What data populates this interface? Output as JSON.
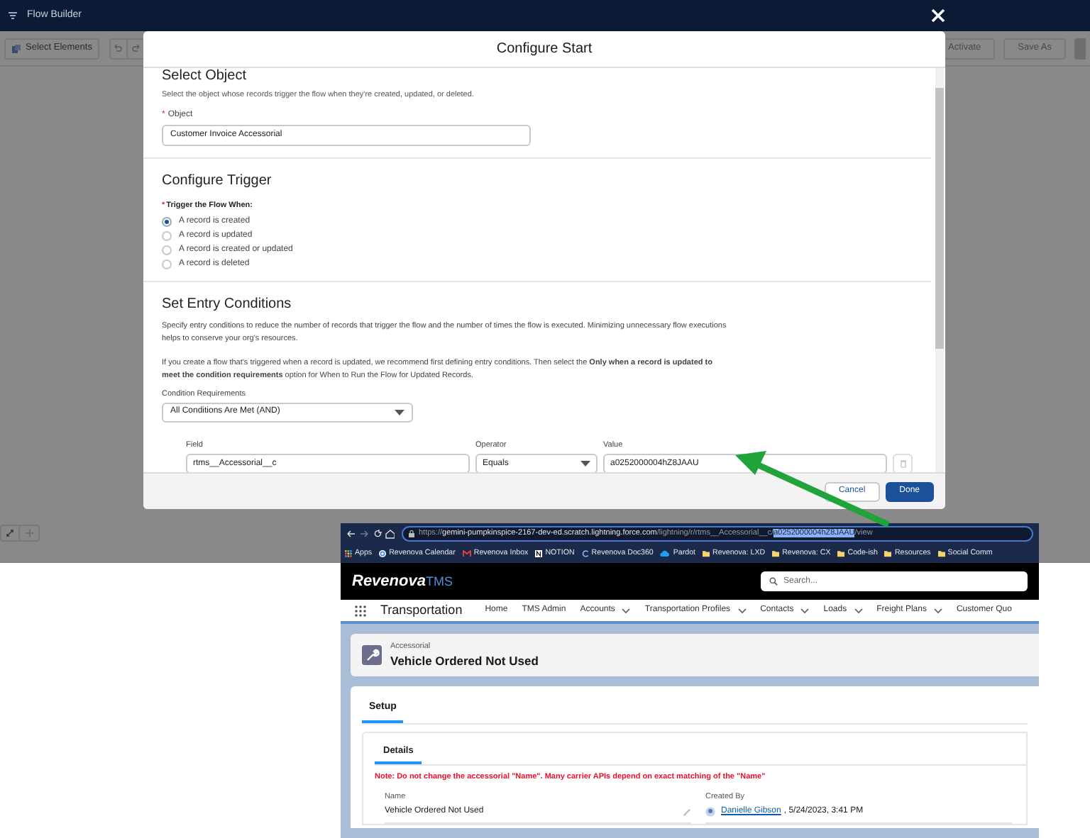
{
  "app_bar": {
    "title": "Flow Builder"
  },
  "toolbar": {
    "left_buttons": [
      {
        "label": "Select Elements"
      }
    ],
    "right_buttons": [
      {
        "label": "Activate"
      },
      {
        "label": "Save As"
      }
    ]
  },
  "modal": {
    "title": "Configure Start",
    "select_object": {
      "heading": "Select Object",
      "description": "Select the object whose records trigger the flow when they're created, updated, or deleted.",
      "required_mark": "*",
      "field_label": "Object",
      "value": "Customer Invoice Accessorial"
    },
    "trigger": {
      "heading": "Configure Trigger",
      "required_mark": "*",
      "label": "Trigger the Flow When:",
      "options": [
        {
          "label": "A record is created",
          "selected": true
        },
        {
          "label": "A record is updated",
          "selected": false
        },
        {
          "label": "A record is created or updated",
          "selected": false
        },
        {
          "label": "A record is deleted",
          "selected": false
        }
      ]
    },
    "entry_conditions": {
      "heading": "Set Entry Conditions",
      "description": "Specify entry conditions to reduce the number of records that trigger the flow and the number of times the flow is executed. Minimizing unnecessary flow executions helps to conserve your org's resources.",
      "note": "If you create a flow that's triggered when a record is updated, we recommend first defining entry conditions. Then select the **Only when a record is updated to meet the condition requirements** option for When to Run the Flow for Updated Records.",
      "requirements_label": "Condition Requirements",
      "requirements_value": "All Conditions Are Met (AND)",
      "condition": {
        "field_label": "Field",
        "field": "rtms__Accessorial__c",
        "operator_label": "Operator",
        "operator": "Equals",
        "value_label": "Value",
        "value": "a0252000004hZ8JAAU"
      }
    },
    "footer_buttons": [
      {
        "label": "Cancel",
        "kind": "neutral"
      },
      {
        "label": "Done",
        "kind": "brand"
      }
    ]
  },
  "browser": {
    "url": {
      "scheme": "https://",
      "host": "gemini-pumpkinspice-2167-dev-ed.scratch.lightning.force.com",
      "path": "/lightning/r/rtms__Accessorial__c/",
      "selected": "a0252000004hZ8JAAU",
      "rest": "/view"
    },
    "bookmarks": [
      {
        "label": "Apps",
        "kind": "grid"
      },
      {
        "label": "Revenova Calendar",
        "kind": "google"
      },
      {
        "label": "Revenova Inbox",
        "kind": "mail"
      },
      {
        "label": "NOTION",
        "kind": "notion"
      },
      {
        "label": "Revenova Doc360",
        "kind": "doc"
      },
      {
        "label": "Pardot",
        "kind": "cloud"
      },
      {
        "label": "Revenova: LXD",
        "kind": "folder"
      },
      {
        "label": "Revenova: CX",
        "kind": "folder"
      },
      {
        "label": "Code-ish",
        "kind": "folder"
      },
      {
        "label": "Resources",
        "kind": "folder"
      },
      {
        "label": "Social Comm",
        "kind": "folder"
      }
    ]
  },
  "salesforce": {
    "logo": {
      "name": "Revenova",
      "suffix": "TMS"
    },
    "search": {
      "placeholder": "Search..."
    },
    "app_name": "Transportation",
    "nav": [
      {
        "label": "Home",
        "dropdown": false
      },
      {
        "label": "TMS Admin",
        "dropdown": false
      },
      {
        "label": "Accounts",
        "dropdown": true
      },
      {
        "label": "Transportation Profiles",
        "dropdown": true
      },
      {
        "label": "Contacts",
        "dropdown": true
      },
      {
        "label": "Loads",
        "dropdown": true
      },
      {
        "label": "Freight Plans",
        "dropdown": true
      },
      {
        "label": "Customer Quo",
        "dropdown": false
      }
    ],
    "record": {
      "object": "Accessorial",
      "name": "Vehicle Ordered Not Used"
    },
    "tabs": [
      {
        "label": "Setup",
        "selected": true
      }
    ],
    "section_tabs": [
      {
        "label": "Details",
        "selected": true
      }
    ],
    "warning": "Note: Do not change the accessorial \"Name\". Many carrier APIs depend on exact matching of the \"Name\"",
    "fields": [
      {
        "label": "Name",
        "value": "Vehicle Ordered Not Used",
        "editable": true
      },
      {
        "label": "Created By",
        "link": "Danielle Gibson",
        "value": ", 5/24/2023, 3:41 PM",
        "editable": false
      }
    ]
  }
}
